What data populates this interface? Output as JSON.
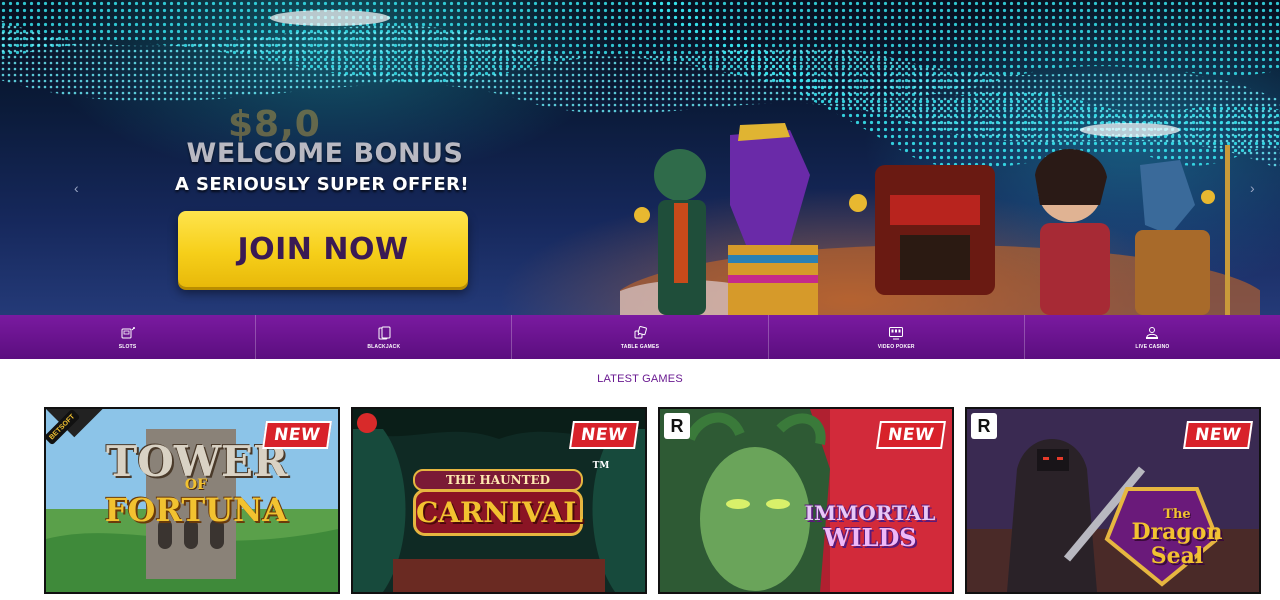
{
  "hero": {
    "bonus_amount": "$8,0",
    "bonus_title": "WELCOME BONUS",
    "bonus_subtitle": "A SERIOUSLY SUPER OFFER!",
    "cta_label": "JOIN NOW",
    "prev_arrow": "‹",
    "next_arrow": "›"
  },
  "categories": [
    {
      "label": "SLOTS",
      "icon": "slot-machine-icon"
    },
    {
      "label": "BLACKJACK",
      "icon": "cards-icon"
    },
    {
      "label": "TABLE GAMES",
      "icon": "dice-icon"
    },
    {
      "label": "VIDEO POKER",
      "icon": "video-poker-icon"
    },
    {
      "label": "LIVE CASINO",
      "icon": "live-dealer-icon"
    }
  ],
  "latest": {
    "title": "LATEST GAMES",
    "games": [
      {
        "badge": "NEW",
        "provider": "BETSOFT",
        "title_line1": "TOWER",
        "title_line2": "OF",
        "title_line3": "FORTUNA"
      },
      {
        "badge": "NEW",
        "provider": "",
        "title_line1": "THE HAUNTED",
        "title_line2": "CARNIVAL",
        "title_line3": "TM"
      },
      {
        "badge": "NEW",
        "provider": "R",
        "title_line1": "IMMORTAL",
        "title_line2": "WILDS",
        "title_line3": ""
      },
      {
        "badge": "NEW",
        "provider": "R",
        "title_line1": "The",
        "title_line2": "Dragon",
        "title_line3": "Seal"
      }
    ]
  },
  "colors": {
    "nav_purple": "#6b1590",
    "cta_yellow": "#f6cf1a",
    "badge_red": "#d8222a",
    "title_purple": "#6a1a91"
  }
}
